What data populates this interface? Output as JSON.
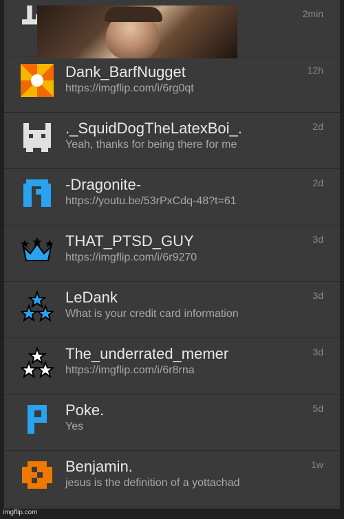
{
  "conversations": [
    {
      "name": "",
      "message": "",
      "time": "2min",
      "icon": "partial-avatar-icon"
    },
    {
      "name": "Dank_BarfNugget",
      "message": "https://imgflip.com/i/6rg0qt",
      "time": "12h",
      "icon": "pinwheel-icon",
      "color": "#f0a000"
    },
    {
      "name": "._SquidDogTheLatexBoi_.",
      "message": "Yeah, thanks for being there for me",
      "time": "2d",
      "icon": "pixel-bunny-icon",
      "color": "#e0e0e0"
    },
    {
      "name": "-Dragonite-",
      "message": "https://youtu.be/53rPxCdq-48?t=61",
      "time": "2d",
      "icon": "pixel-arch-icon",
      "color": "#29a3f0"
    },
    {
      "name": "THAT_PTSD_GUY",
      "message": "https://imgflip.com/i/6r9270",
      "time": "3d",
      "icon": "crown-icon",
      "color": "#29a3f0"
    },
    {
      "name": "LeDank",
      "message": "What is your credit card information",
      "time": "3d",
      "icon": "three-stars-icon",
      "color": "#29a3f0"
    },
    {
      "name": "The_underrated_memer",
      "message": "https://imgflip.com/i/6r8rna",
      "time": "3d",
      "icon": "three-stars-white-icon",
      "color": "#ffffff"
    },
    {
      "name": "Poke.",
      "message": "Yes",
      "time": "5d",
      "icon": "pixel-p-icon",
      "color": "#29a3f0"
    },
    {
      "name": "Benjamin.",
      "message": "jesus is the definition of a yottachad",
      "time": "1w",
      "icon": "pixel-checker-icon",
      "color": "#f07800"
    }
  ],
  "watermark": "imgflip.com"
}
